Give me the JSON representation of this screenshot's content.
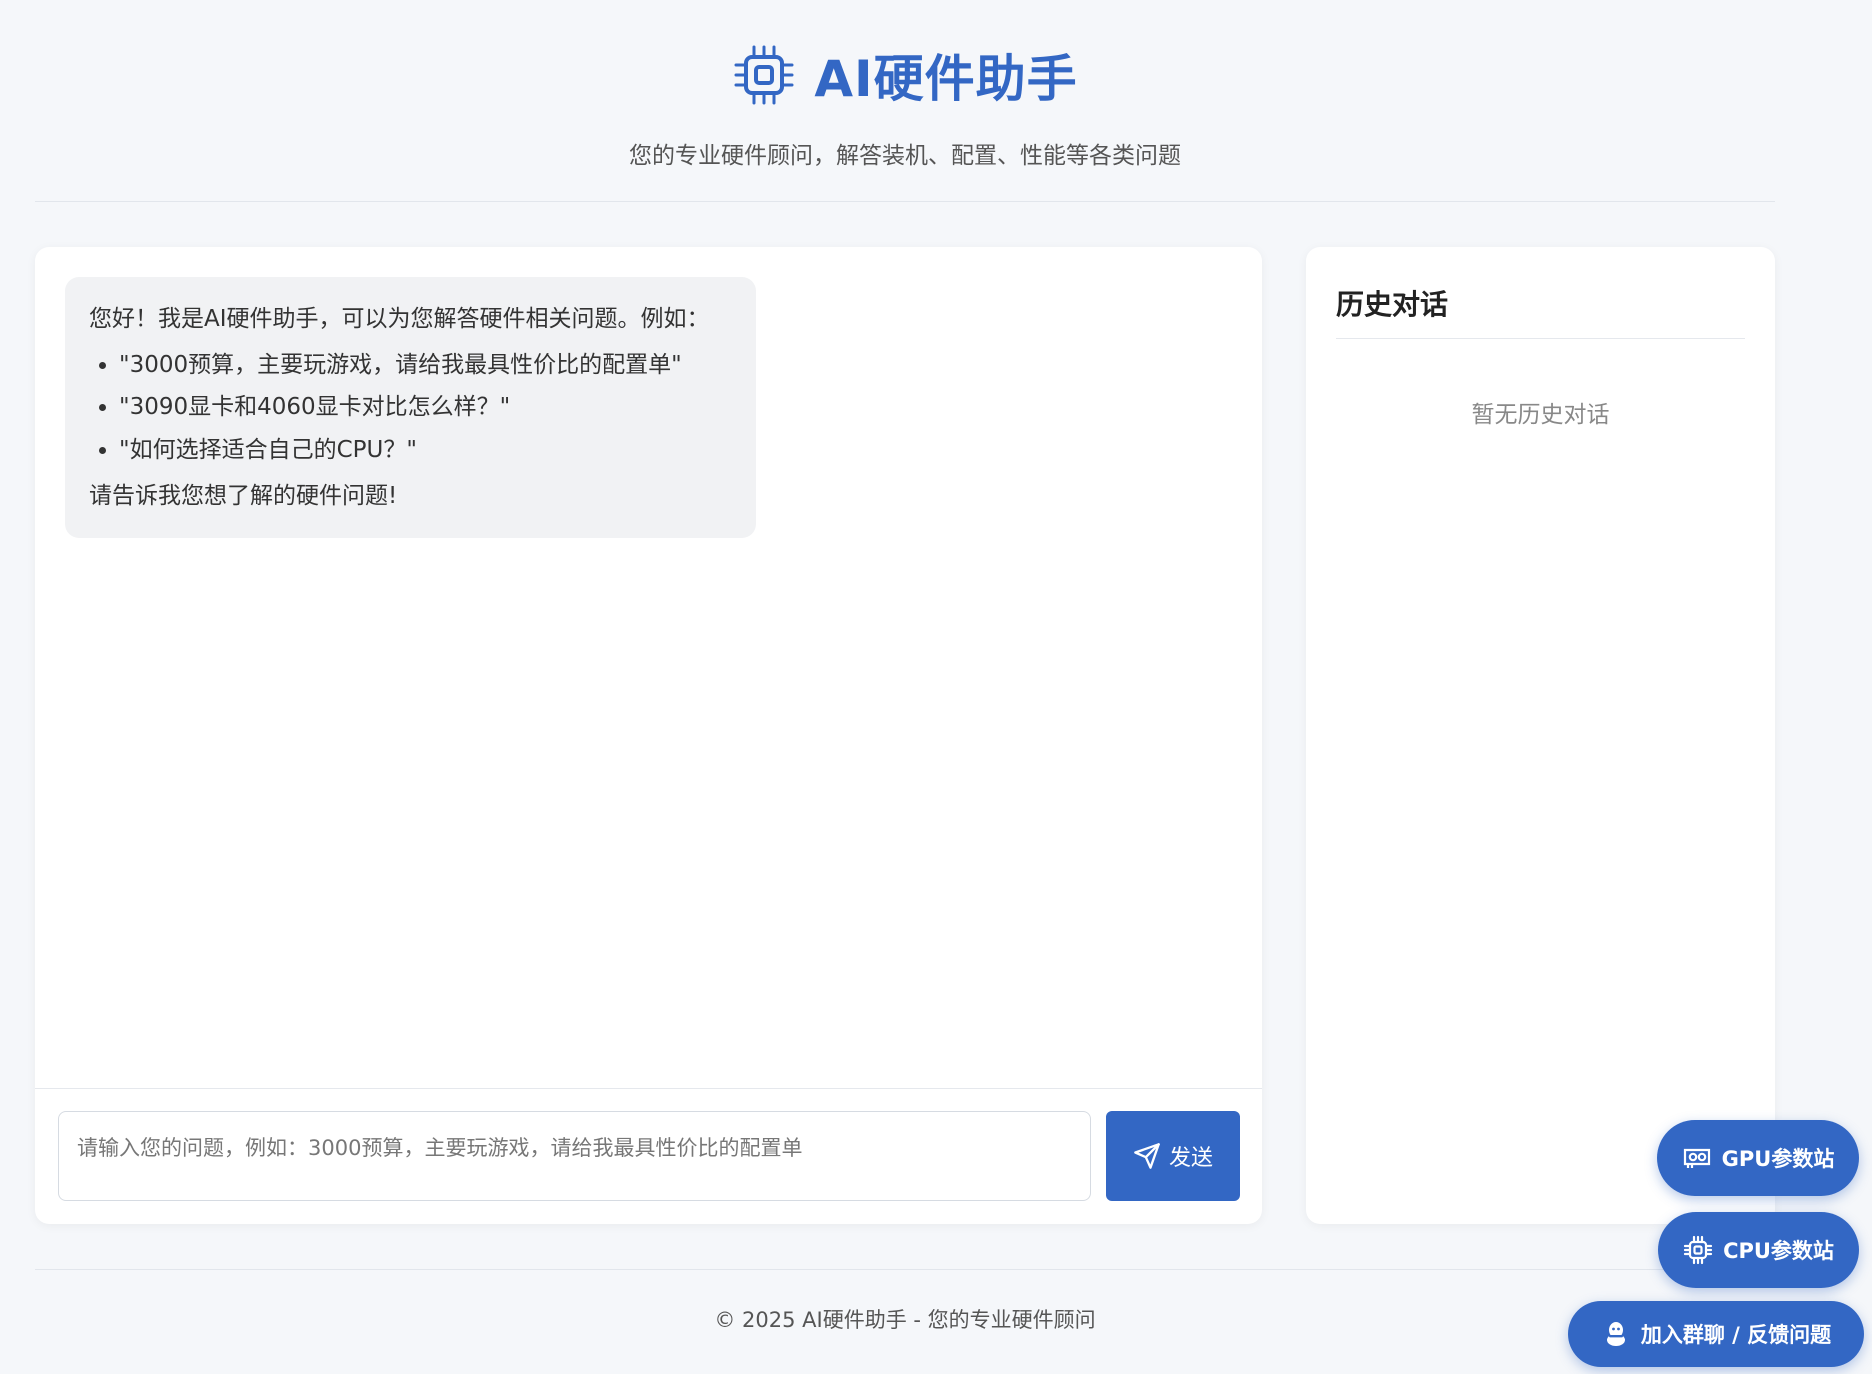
{
  "header": {
    "logo_icon": "cpu-chip-icon",
    "title": "AI硬件助手",
    "subtitle": "您的专业硬件顾问，解答装机、配置、性能等各类问题",
    "accent_color": "#3367c4"
  },
  "chat": {
    "welcome": {
      "intro": "您好！我是AI硬件助手，可以为您解答硬件相关问题。例如：",
      "examples": [
        "\"3000预算，主要玩游戏，请给我最具性价比的配置单\"",
        "\"3090显卡和4060显卡对比怎么样？\"",
        "\"如何选择适合自己的CPU？\""
      ],
      "outro": "请告诉我您想了解的硬件问题!"
    },
    "input_placeholder": "请输入您的问题，例如：3000预算，主要玩游戏，请给我最具性价比的配置单",
    "send_label": "发送",
    "send_icon": "paper-plane-icon"
  },
  "history": {
    "title": "历史对话",
    "empty_text": "暂无历史对话"
  },
  "footer": {
    "text": "© 2025 AI硬件助手 - 您的专业硬件顾问"
  },
  "floating_buttons": {
    "gpu": {
      "label": "GPU参数站",
      "icon": "graphics-card-icon"
    },
    "cpu": {
      "label": "CPU参数站",
      "icon": "cpu-chip-icon"
    },
    "join": {
      "label": "加入群聊 / 反馈问题",
      "icon": "qq-penguin-icon"
    }
  }
}
